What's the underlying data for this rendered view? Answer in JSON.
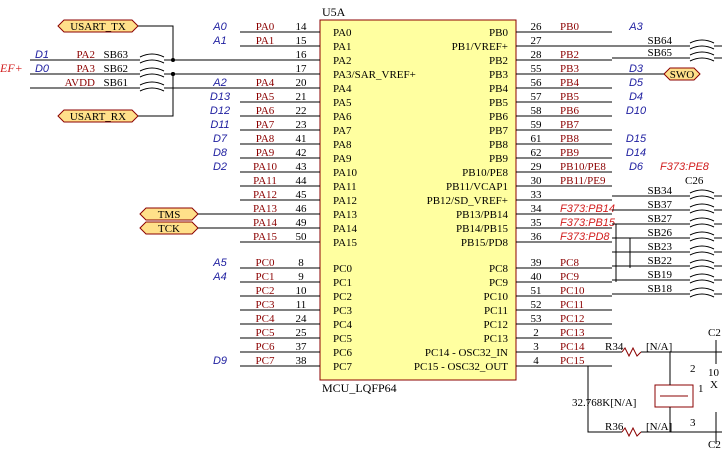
{
  "component": {
    "designator": "U5A",
    "part": "MCU_LQFP64"
  },
  "colors": {
    "body_fill": "#ffffa0",
    "body_stroke": "#8b0000",
    "wire": "#000000",
    "pin_text": "#8b0000",
    "net_text": "#1f1fa0",
    "note_text": "#d21e1e",
    "port_fill": "#ffe08a",
    "port_stroke": "#8b0000"
  },
  "left_pins": [
    {
      "num": "14",
      "name": "PA0",
      "net": "PA0",
      "label": "A0"
    },
    {
      "num": "15",
      "name": "PA1",
      "net": "PA1",
      "label": "A1"
    },
    {
      "num": "16",
      "name": "PA2",
      "net": "",
      "label": ""
    },
    {
      "num": "17",
      "name": "PA3/SAR_VREF+",
      "net": "",
      "label": ""
    },
    {
      "num": "20",
      "name": "PA4",
      "net": "PA4",
      "label": "A2"
    },
    {
      "num": "21",
      "name": "PA5",
      "net": "PA5",
      "label": "D13"
    },
    {
      "num": "22",
      "name": "PA6",
      "net": "PA6",
      "label": "D12"
    },
    {
      "num": "23",
      "name": "PA7",
      "net": "PA7",
      "label": "D11"
    },
    {
      "num": "41",
      "name": "PA8",
      "net": "PA8",
      "label": "D7"
    },
    {
      "num": "42",
      "name": "PA9",
      "net": "PA9",
      "label": "D8"
    },
    {
      "num": "43",
      "name": "PA10",
      "net": "PA10",
      "label": "D2"
    },
    {
      "num": "44",
      "name": "PA11",
      "net": "PA11",
      "label": ""
    },
    {
      "num": "45",
      "name": "PA12",
      "net": "PA12",
      "label": ""
    },
    {
      "num": "46",
      "name": "PA13",
      "net": "PA13",
      "label": ""
    },
    {
      "num": "49",
      "name": "PA14",
      "net": "PA14",
      "label": ""
    },
    {
      "num": "50",
      "name": "PA15",
      "net": "PA15",
      "label": ""
    },
    {
      "num": "8",
      "name": "PC0",
      "net": "PC0",
      "label": "A5"
    },
    {
      "num": "9",
      "name": "PC1",
      "net": "PC1",
      "label": "A4"
    },
    {
      "num": "10",
      "name": "PC2",
      "net": "PC2",
      "label": ""
    },
    {
      "num": "11",
      "name": "PC3",
      "net": "PC3",
      "label": ""
    },
    {
      "num": "24",
      "name": "PC4",
      "net": "PC4",
      "label": ""
    },
    {
      "num": "25",
      "name": "PC5",
      "net": "PC5",
      "label": ""
    },
    {
      "num": "37",
      "name": "PC6",
      "net": "PC6",
      "label": ""
    },
    {
      "num": "38",
      "name": "PC7",
      "net": "PC7",
      "label": "D9"
    }
  ],
  "right_pins": [
    {
      "num": "26",
      "name": "PB0",
      "net": "PB0",
      "label": "A3",
      "note": ""
    },
    {
      "num": "27",
      "name": "PB1/VREF+",
      "net": "",
      "label": "",
      "note": ""
    },
    {
      "num": "28",
      "name": "PB2",
      "net": "PB2",
      "label": "",
      "note": ""
    },
    {
      "num": "55",
      "name": "PB3",
      "net": "PB3",
      "label": "D3",
      "note": ""
    },
    {
      "num": "56",
      "name": "PB4",
      "net": "PB4",
      "label": "D5",
      "note": ""
    },
    {
      "num": "57",
      "name": "PB5",
      "net": "PB5",
      "label": "D4",
      "note": ""
    },
    {
      "num": "58",
      "name": "PB6",
      "net": "PB6",
      "label": "D10",
      "note": ""
    },
    {
      "num": "59",
      "name": "PB7",
      "net": "PB7",
      "label": "",
      "note": ""
    },
    {
      "num": "61",
      "name": "PB8",
      "net": "PB8",
      "label": "D15",
      "note": ""
    },
    {
      "num": "62",
      "name": "PB9",
      "net": "PB9",
      "label": "D14",
      "note": ""
    },
    {
      "num": "29",
      "name": "PB10/PE8",
      "net": "PB10/PE8",
      "label": "D6",
      "note": "F373:PE8"
    },
    {
      "num": "30",
      "name": "PB11/VCAP1",
      "net": "PB11/PE9",
      "label": "",
      "note": ""
    },
    {
      "num": "33",
      "name": "PB12/SD_VREF+",
      "net": "",
      "label": "",
      "note": ""
    },
    {
      "num": "34",
      "name": "PB13/PB14",
      "net": "F373:PB14",
      "label": "",
      "note": ""
    },
    {
      "num": "35",
      "name": "PB14/PB15",
      "net": "F373:PB15",
      "label": "",
      "note": ""
    },
    {
      "num": "36",
      "name": "PB15/PD8",
      "net": "F373:PD8",
      "label": "",
      "note": ""
    },
    {
      "num": "39",
      "name": "PC8",
      "net": "PC8",
      "label": "",
      "note": ""
    },
    {
      "num": "40",
      "name": "PC9",
      "net": "PC9",
      "label": "",
      "note": ""
    },
    {
      "num": "51",
      "name": "PC10",
      "net": "PC10",
      "label": "",
      "note": ""
    },
    {
      "num": "52",
      "name": "PC11",
      "net": "PC11",
      "label": "",
      "note": ""
    },
    {
      "num": "53",
      "name": "PC12",
      "net": "PC12",
      "label": "",
      "note": ""
    },
    {
      "num": "2",
      "name": "PC13",
      "net": "PC13",
      "label": "",
      "note": ""
    },
    {
      "num": "3",
      "name": "PC14 - OSC32_IN",
      "net": "PC14",
      "label": "",
      "note": ""
    },
    {
      "num": "4",
      "name": "PC15 - OSC32_OUT",
      "net": "PC15",
      "label": "",
      "note": ""
    }
  ],
  "ports": {
    "usart_tx": "USART_TX",
    "usart_rx": "USART_RX",
    "tms": "TMS",
    "tck": "TCK",
    "swo": "SWO"
  },
  "solder_bridges_left": [
    {
      "net": "PA2",
      "ref": "SB63",
      "label": "D1"
    },
    {
      "net": "PA3",
      "ref": "SB62",
      "label": "D0"
    },
    {
      "net": "AVDD",
      "ref": "SB61",
      "label": ""
    }
  ],
  "left_edge_net": "EF+",
  "solder_bridges_right": [
    "SB64",
    "SB65",
    "SB34",
    "SB37",
    "SB27",
    "SB26",
    "SB23",
    "SB22",
    "SB19",
    "SB18"
  ],
  "cap_c26": "C26",
  "resistors": [
    "R34",
    "R36"
  ],
  "resistor_values": [
    "[N/A]",
    "[N/A]"
  ],
  "crystal": {
    "ref": "X",
    "value": "32.768K[N/A]",
    "pin1": "1",
    "pin2": "2",
    "pin3": "3"
  },
  "right_edge_labels": [
    "C2",
    "10",
    "C2"
  ]
}
